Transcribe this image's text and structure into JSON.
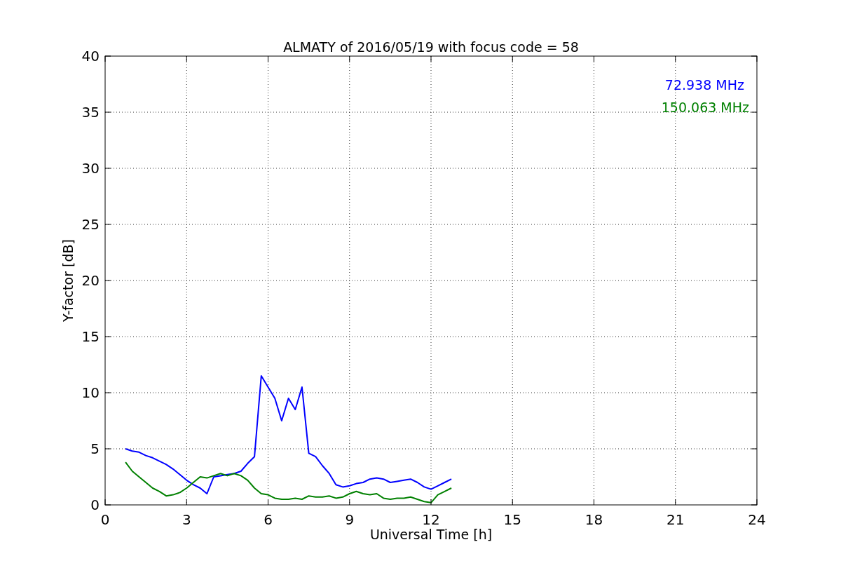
{
  "chart_data": {
    "type": "line",
    "title": "ALMATY of 2016/05/19 with focus code = 58",
    "xlabel": "Universal Time [h]",
    "ylabel": "Y-factor [dB]",
    "x": [
      0.75,
      1.0,
      1.25,
      1.5,
      1.75,
      2.0,
      2.25,
      2.5,
      2.75,
      3.0,
      3.25,
      3.5,
      3.75,
      4.0,
      4.25,
      4.5,
      4.75,
      5.0,
      5.25,
      5.5,
      5.75,
      6.0,
      6.25,
      6.5,
      6.75,
      7.0,
      7.25,
      7.5,
      7.75,
      8.0,
      8.25,
      8.5,
      8.75,
      9.0,
      9.25,
      9.5,
      9.75,
      10.0,
      10.25,
      10.5,
      10.75,
      11.0,
      11.25,
      11.5,
      11.75,
      12.0,
      12.25,
      12.5,
      12.75
    ],
    "series": [
      {
        "name": "72.938 MHz",
        "color": "#0000ff",
        "values": [
          5.0,
          4.8,
          4.7,
          4.4,
          4.2,
          3.9,
          3.6,
          3.2,
          2.7,
          2.2,
          1.8,
          1.5,
          1.0,
          2.5,
          2.6,
          2.7,
          2.8,
          3.0,
          3.7,
          4.3,
          11.5,
          10.5,
          9.5,
          7.5,
          9.5,
          8.5,
          10.5,
          4.6,
          4.3,
          3.5,
          2.8,
          1.8,
          1.6,
          1.7,
          1.9,
          2.0,
          2.3,
          2.4,
          2.3,
          2.0,
          2.1,
          2.2,
          2.3,
          2.0,
          1.6,
          1.4,
          1.7,
          2.0,
          2.3
        ]
      },
      {
        "name": "150.063 MHz",
        "color": "#008000",
        "values": [
          3.8,
          3.0,
          2.5,
          2.0,
          1.5,
          1.2,
          0.8,
          0.9,
          1.1,
          1.5,
          2.0,
          2.5,
          2.4,
          2.6,
          2.8,
          2.6,
          2.8,
          2.6,
          2.2,
          1.5,
          1.0,
          0.9,
          0.6,
          0.5,
          0.5,
          0.6,
          0.5,
          0.8,
          0.7,
          0.7,
          0.8,
          0.6,
          0.7,
          1.0,
          1.2,
          1.0,
          0.9,
          1.0,
          0.6,
          0.5,
          0.6,
          0.6,
          0.7,
          0.5,
          0.3,
          0.2,
          0.9,
          1.2,
          1.5
        ]
      }
    ],
    "xlim": [
      0,
      24
    ],
    "ylim": [
      0,
      40
    ],
    "xticks": [
      0,
      3,
      6,
      9,
      12,
      15,
      18,
      21,
      24
    ],
    "yticks": [
      0,
      5,
      10,
      15,
      20,
      25,
      30,
      35,
      40
    ],
    "grid": true
  }
}
